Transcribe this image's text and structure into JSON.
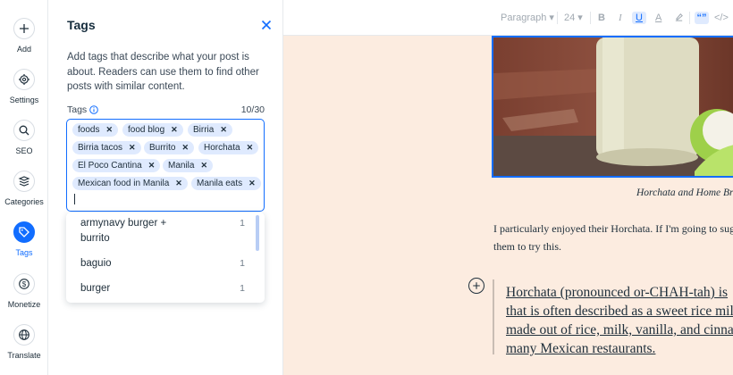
{
  "rail": {
    "items": [
      {
        "label": "Add",
        "icon": "plus-icon"
      },
      {
        "label": "Settings",
        "icon": "gear-icon"
      },
      {
        "label": "SEO",
        "icon": "search-icon"
      },
      {
        "label": "Categories",
        "icon": "categories-icon"
      },
      {
        "label": "Tags",
        "icon": "tag-icon",
        "active": true
      },
      {
        "label": "Monetize",
        "icon": "dollar-icon"
      },
      {
        "label": "Translate",
        "icon": "globe-icon"
      }
    ]
  },
  "panel": {
    "title": "Tags",
    "description": "Add tags that describe what your post is about. Readers can use them to find other posts with similar content.",
    "tags_label": "Tags",
    "tags_count": "10/30",
    "tags": [
      "foods",
      "food blog",
      "Birria",
      "Birria tacos",
      "Burrito",
      "Horchata",
      "El Poco Cantina",
      "Manila",
      "Mexican food in Manila",
      "Manila eats"
    ],
    "suggestions": [
      {
        "label": "armynavy burger + burrito",
        "count": "1"
      },
      {
        "label": "baguio",
        "count": "1"
      },
      {
        "label": "burger",
        "count": "1"
      }
    ]
  },
  "toolbar": {
    "paragraph": "Paragraph",
    "font_size": "24",
    "bold": "B",
    "italic": "I",
    "underline": "U",
    "text_color": "A",
    "quote": "“”",
    "code": "</>"
  },
  "editor": {
    "caption": "Horchata and Home Brewed",
    "body_line1": "I particularly enjoyed their Horchata. If I'm going to suggest",
    "body_line2": "them to try this.",
    "quote_lines": [
      "Horchata (pronounced or-CHAH-tah) is",
      "that is often described as a sweet rice milk",
      "made out of rice, milk, vanilla, and cinnamon",
      "many Mexican restaurants."
    ]
  },
  "colors": {
    "accent": "#116dff",
    "chip_bg": "#dfeafe",
    "editor_bg": "#fcece0"
  }
}
